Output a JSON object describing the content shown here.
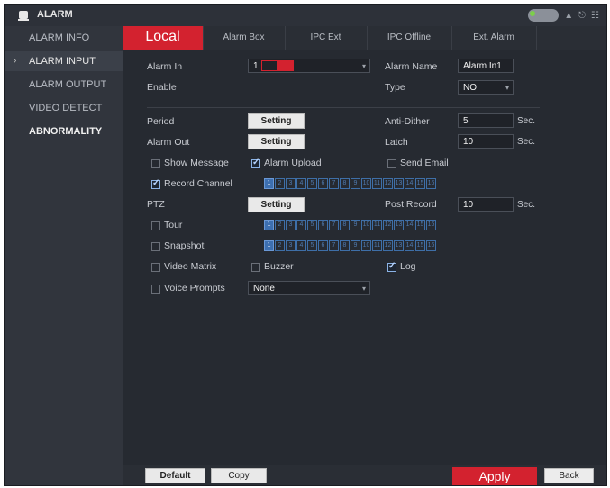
{
  "window": {
    "title": "ALARM"
  },
  "sidebar": {
    "items": [
      {
        "label": "ALARM INFO"
      },
      {
        "label": "ALARM INPUT"
      },
      {
        "label": "ALARM OUTPUT"
      },
      {
        "label": "VIDEO DETECT"
      },
      {
        "label": "ABNORMALITY"
      }
    ]
  },
  "tabs": [
    {
      "label": "Local"
    },
    {
      "label": "Alarm Box"
    },
    {
      "label": "IPC Ext"
    },
    {
      "label": "IPC Offline"
    },
    {
      "label": "Ext. Alarm"
    }
  ],
  "form": {
    "alarm_in_label": "Alarm In",
    "alarm_in_value": "1",
    "alarm_name_label": "Alarm Name",
    "alarm_name_value": "Alarm In1",
    "enable_label": "Enable",
    "type_label": "Type",
    "type_value": "NO",
    "period_label": "Period",
    "setting_label": "Setting",
    "anti_dither_label": "Anti-Dither",
    "anti_dither_value": "5",
    "sec_label": "Sec.",
    "alarm_out_label": "Alarm Out",
    "latch_label": "Latch",
    "latch_value": "10",
    "show_message_label": "Show Message",
    "alarm_upload_label": "Alarm Upload",
    "send_email_label": "Send Email",
    "record_channel_label": "Record Channel",
    "ptz_label": "PTZ",
    "post_record_label": "Post Record",
    "post_record_value": "10",
    "tour_label": "Tour",
    "snapshot_label": "Snapshot",
    "video_matrix_label": "Video Matrix",
    "buzzer_label": "Buzzer",
    "log_label": "Log",
    "voice_prompts_label": "Voice Prompts",
    "voice_prompts_value": "None",
    "channels": [
      "1",
      "2",
      "3",
      "4",
      "5",
      "6",
      "7",
      "8",
      "9",
      "10",
      "11",
      "12",
      "13",
      "14",
      "15",
      "16"
    ]
  },
  "footer": {
    "default_label": "Default",
    "copy_label": "Copy",
    "apply_label": "Apply",
    "back_label": "Back"
  },
  "colors": {
    "accent": "#d3222f",
    "background": "#262a31",
    "channel_selected": "#3d6fb0"
  },
  "icons": [
    "alarm-bell-icon",
    "user-icon",
    "logout-icon",
    "menu-icon"
  ]
}
